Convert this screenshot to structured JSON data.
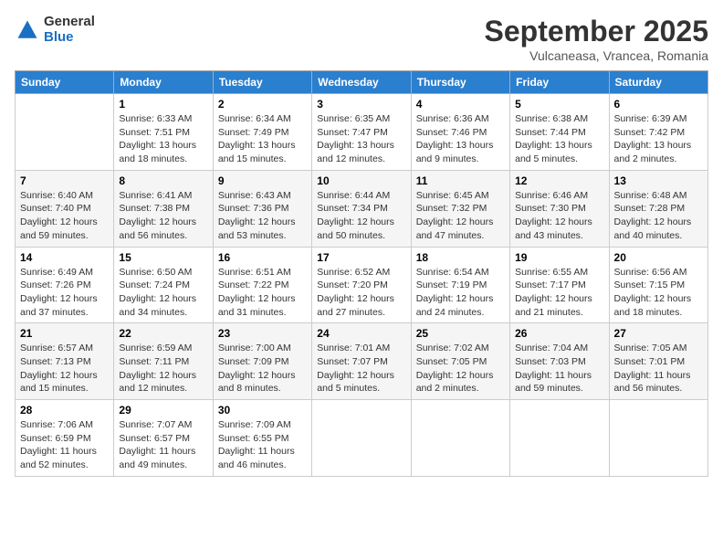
{
  "header": {
    "logo": {
      "general": "General",
      "blue": "Blue"
    },
    "title": "September 2025",
    "location": "Vulcaneasa, Vrancea, Romania"
  },
  "calendar": {
    "columns": [
      "Sunday",
      "Monday",
      "Tuesday",
      "Wednesday",
      "Thursday",
      "Friday",
      "Saturday"
    ],
    "weeks": [
      [
        {
          "day": "",
          "sunrise": "",
          "sunset": "",
          "daylight": ""
        },
        {
          "day": "1",
          "sunrise": "Sunrise: 6:33 AM",
          "sunset": "Sunset: 7:51 PM",
          "daylight": "Daylight: 13 hours and 18 minutes."
        },
        {
          "day": "2",
          "sunrise": "Sunrise: 6:34 AM",
          "sunset": "Sunset: 7:49 PM",
          "daylight": "Daylight: 13 hours and 15 minutes."
        },
        {
          "day": "3",
          "sunrise": "Sunrise: 6:35 AM",
          "sunset": "Sunset: 7:47 PM",
          "daylight": "Daylight: 13 hours and 12 minutes."
        },
        {
          "day": "4",
          "sunrise": "Sunrise: 6:36 AM",
          "sunset": "Sunset: 7:46 PM",
          "daylight": "Daylight: 13 hours and 9 minutes."
        },
        {
          "day": "5",
          "sunrise": "Sunrise: 6:38 AM",
          "sunset": "Sunset: 7:44 PM",
          "daylight": "Daylight: 13 hours and 5 minutes."
        },
        {
          "day": "6",
          "sunrise": "Sunrise: 6:39 AM",
          "sunset": "Sunset: 7:42 PM",
          "daylight": "Daylight: 13 hours and 2 minutes."
        }
      ],
      [
        {
          "day": "7",
          "sunrise": "Sunrise: 6:40 AM",
          "sunset": "Sunset: 7:40 PM",
          "daylight": "Daylight: 12 hours and 59 minutes."
        },
        {
          "day": "8",
          "sunrise": "Sunrise: 6:41 AM",
          "sunset": "Sunset: 7:38 PM",
          "daylight": "Daylight: 12 hours and 56 minutes."
        },
        {
          "day": "9",
          "sunrise": "Sunrise: 6:43 AM",
          "sunset": "Sunset: 7:36 PM",
          "daylight": "Daylight: 12 hours and 53 minutes."
        },
        {
          "day": "10",
          "sunrise": "Sunrise: 6:44 AM",
          "sunset": "Sunset: 7:34 PM",
          "daylight": "Daylight: 12 hours and 50 minutes."
        },
        {
          "day": "11",
          "sunrise": "Sunrise: 6:45 AM",
          "sunset": "Sunset: 7:32 PM",
          "daylight": "Daylight: 12 hours and 47 minutes."
        },
        {
          "day": "12",
          "sunrise": "Sunrise: 6:46 AM",
          "sunset": "Sunset: 7:30 PM",
          "daylight": "Daylight: 12 hours and 43 minutes."
        },
        {
          "day": "13",
          "sunrise": "Sunrise: 6:48 AM",
          "sunset": "Sunset: 7:28 PM",
          "daylight": "Daylight: 12 hours and 40 minutes."
        }
      ],
      [
        {
          "day": "14",
          "sunrise": "Sunrise: 6:49 AM",
          "sunset": "Sunset: 7:26 PM",
          "daylight": "Daylight: 12 hours and 37 minutes."
        },
        {
          "day": "15",
          "sunrise": "Sunrise: 6:50 AM",
          "sunset": "Sunset: 7:24 PM",
          "daylight": "Daylight: 12 hours and 34 minutes."
        },
        {
          "day": "16",
          "sunrise": "Sunrise: 6:51 AM",
          "sunset": "Sunset: 7:22 PM",
          "daylight": "Daylight: 12 hours and 31 minutes."
        },
        {
          "day": "17",
          "sunrise": "Sunrise: 6:52 AM",
          "sunset": "Sunset: 7:20 PM",
          "daylight": "Daylight: 12 hours and 27 minutes."
        },
        {
          "day": "18",
          "sunrise": "Sunrise: 6:54 AM",
          "sunset": "Sunset: 7:19 PM",
          "daylight": "Daylight: 12 hours and 24 minutes."
        },
        {
          "day": "19",
          "sunrise": "Sunrise: 6:55 AM",
          "sunset": "Sunset: 7:17 PM",
          "daylight": "Daylight: 12 hours and 21 minutes."
        },
        {
          "day": "20",
          "sunrise": "Sunrise: 6:56 AM",
          "sunset": "Sunset: 7:15 PM",
          "daylight": "Daylight: 12 hours and 18 minutes."
        }
      ],
      [
        {
          "day": "21",
          "sunrise": "Sunrise: 6:57 AM",
          "sunset": "Sunset: 7:13 PM",
          "daylight": "Daylight: 12 hours and 15 minutes."
        },
        {
          "day": "22",
          "sunrise": "Sunrise: 6:59 AM",
          "sunset": "Sunset: 7:11 PM",
          "daylight": "Daylight: 12 hours and 12 minutes."
        },
        {
          "day": "23",
          "sunrise": "Sunrise: 7:00 AM",
          "sunset": "Sunset: 7:09 PM",
          "daylight": "Daylight: 12 hours and 8 minutes."
        },
        {
          "day": "24",
          "sunrise": "Sunrise: 7:01 AM",
          "sunset": "Sunset: 7:07 PM",
          "daylight": "Daylight: 12 hours and 5 minutes."
        },
        {
          "day": "25",
          "sunrise": "Sunrise: 7:02 AM",
          "sunset": "Sunset: 7:05 PM",
          "daylight": "Daylight: 12 hours and 2 minutes."
        },
        {
          "day": "26",
          "sunrise": "Sunrise: 7:04 AM",
          "sunset": "Sunset: 7:03 PM",
          "daylight": "Daylight: 11 hours and 59 minutes."
        },
        {
          "day": "27",
          "sunrise": "Sunrise: 7:05 AM",
          "sunset": "Sunset: 7:01 PM",
          "daylight": "Daylight: 11 hours and 56 minutes."
        }
      ],
      [
        {
          "day": "28",
          "sunrise": "Sunrise: 7:06 AM",
          "sunset": "Sunset: 6:59 PM",
          "daylight": "Daylight: 11 hours and 52 minutes."
        },
        {
          "day": "29",
          "sunrise": "Sunrise: 7:07 AM",
          "sunset": "Sunset: 6:57 PM",
          "daylight": "Daylight: 11 hours and 49 minutes."
        },
        {
          "day": "30",
          "sunrise": "Sunrise: 7:09 AM",
          "sunset": "Sunset: 6:55 PM",
          "daylight": "Daylight: 11 hours and 46 minutes."
        },
        {
          "day": "",
          "sunrise": "",
          "sunset": "",
          "daylight": ""
        },
        {
          "day": "",
          "sunrise": "",
          "sunset": "",
          "daylight": ""
        },
        {
          "day": "",
          "sunrise": "",
          "sunset": "",
          "daylight": ""
        },
        {
          "day": "",
          "sunrise": "",
          "sunset": "",
          "daylight": ""
        }
      ]
    ]
  }
}
